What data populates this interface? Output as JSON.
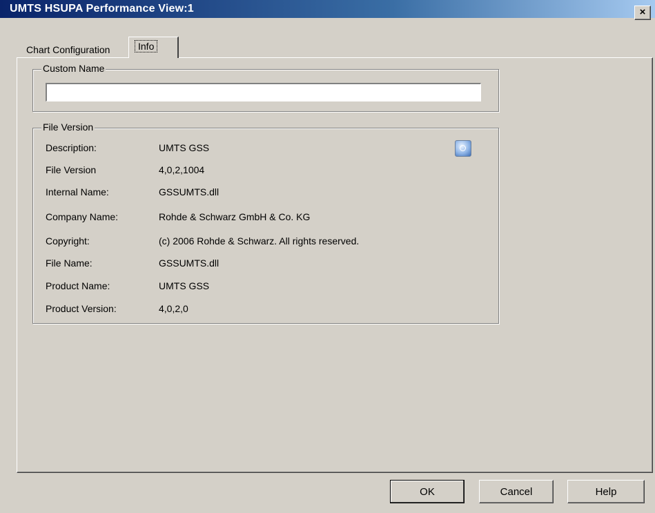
{
  "window": {
    "title": "UMTS HSUPA Performance View:1",
    "close_glyph": "×"
  },
  "tabs": [
    {
      "label": "Chart Configuration"
    },
    {
      "label": "Info",
      "selected": true
    }
  ],
  "custom_name": {
    "legend": "Custom Name",
    "value": "",
    "placeholder": ""
  },
  "file_version": {
    "legend": "File Version",
    "icon": "info-icon",
    "rows": [
      {
        "label": "Description:",
        "value": "UMTS GSS"
      },
      {
        "label": "File Version",
        "value": "4,0,2,1004"
      },
      {
        "label": "Internal Name:",
        "value": "GSSUMTS.dll"
      },
      {
        "label": "Company Name:",
        "value": "Rohde & Schwarz GmbH & Co. KG"
      },
      {
        "label": "Copyright:",
        "value": "(c) 2006 Rohde & Schwarz. All rights reserved."
      },
      {
        "label": "File Name:",
        "value": "GSSUMTS.dll"
      },
      {
        "label": "Product Name:",
        "value": "UMTS GSS"
      },
      {
        "label": "Product Version:",
        "value": "4,0,2,0"
      }
    ]
  },
  "buttons": {
    "ok": "OK",
    "cancel": "Cancel",
    "help": "Help"
  }
}
